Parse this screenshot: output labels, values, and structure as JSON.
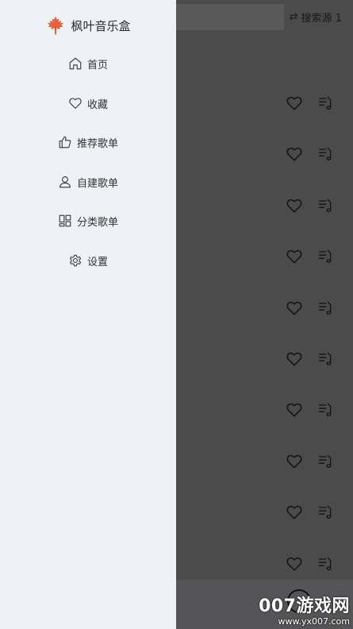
{
  "app": {
    "title": "枫叶音乐盒",
    "logo_icon": "maple-leaf-icon",
    "logo_color": "#e8603c"
  },
  "drawer": {
    "items": [
      {
        "label": "首页",
        "icon": "home-icon"
      },
      {
        "label": "收藏",
        "icon": "heart-icon"
      },
      {
        "label": "推荐歌单",
        "icon": "thumbs-up-icon"
      },
      {
        "label": "自建歌单",
        "icon": "user-icon"
      },
      {
        "label": "分类歌单",
        "icon": "grid-icon"
      },
      {
        "label": "设置",
        "icon": "gear-icon"
      }
    ]
  },
  "background": {
    "source_label": "搜索源 1",
    "source_icon": "swap-icon",
    "row_count": 10,
    "row_icons": [
      "heart-icon",
      "add-to-playlist-icon"
    ]
  },
  "watermark": {
    "brand": "007游戏网",
    "url": "www.yx007.com"
  },
  "colors": {
    "drawer_bg": "#eef2f6",
    "overlay_bg": "#4c4b4c",
    "text": "#333333"
  }
}
